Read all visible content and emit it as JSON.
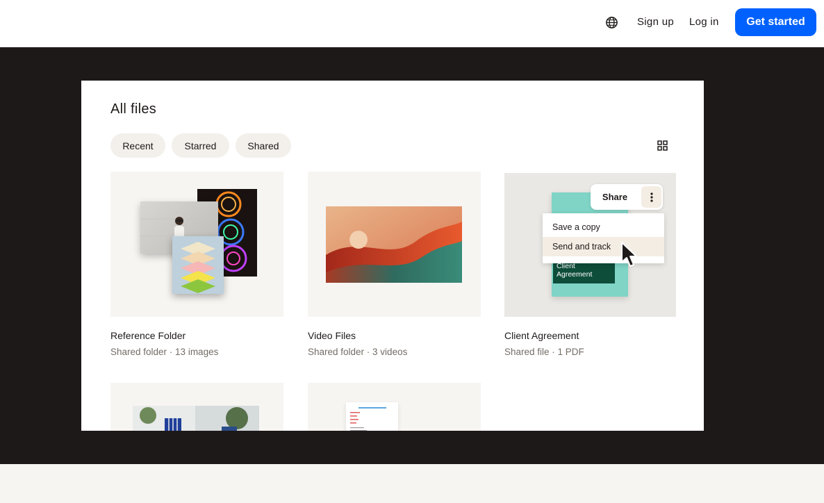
{
  "nav": {
    "globe_icon": "globe-icon",
    "sign_up": "Sign up",
    "log_in": "Log in",
    "get_started": "Get started",
    "accent": "#0061fe"
  },
  "files": {
    "title": "All files",
    "tabs": [
      {
        "label": "Recent"
      },
      {
        "label": "Starred"
      },
      {
        "label": "Shared"
      }
    ],
    "view_toggle_icon": "grid-view-icon",
    "items": [
      {
        "name": "Reference Folder",
        "meta": "Shared folder · 13 images"
      },
      {
        "name": "Video Files",
        "meta": "Shared folder · 3 videos"
      },
      {
        "name": "Client Agreement",
        "meta": "Shared file · 1 PDF",
        "doc_label": "Client Agreement"
      }
    ],
    "share_button": "Share",
    "more_icon": "more-vertical-icon",
    "context_menu": [
      {
        "label": "Save a copy"
      },
      {
        "label": "Send and track"
      }
    ],
    "cursor_icon": "mouse-pointer-icon"
  }
}
